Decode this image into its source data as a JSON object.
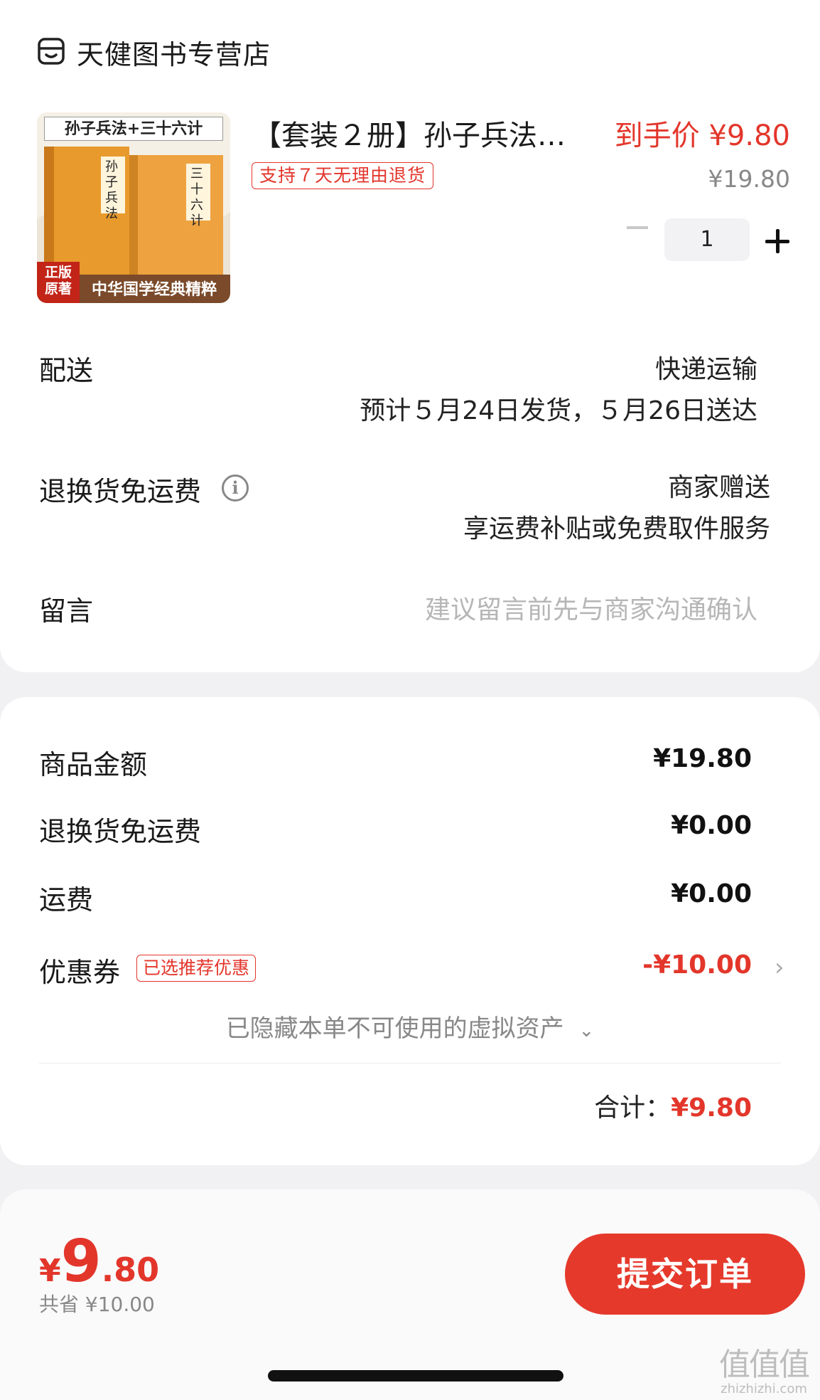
{
  "store": {
    "name": "天健图书专营店",
    "icon": "store-icon"
  },
  "product": {
    "title": "【套装２册】孙子兵法…",
    "return_badge": "支持７天无理由退货",
    "final_price_label": "到手价 ¥9.80",
    "original_price": "¥19.80",
    "quantity": "1",
    "image_text": {
      "banner": "孙子兵法+三十六计",
      "book1": "孙子兵法",
      "book2": "三十六计",
      "seal_line1": "正版",
      "seal_line2": "原著",
      "bottom": "中华国学经典精粹"
    }
  },
  "delivery": {
    "label": "配送",
    "method": "快递运输",
    "estimate": "预计５月24日发货，５月26日送达"
  },
  "return_shipping": {
    "label": "退换货免运费",
    "value": "商家赠送",
    "detail": "享运费补贴或免费取件服务",
    "icon": "info-icon"
  },
  "message": {
    "label": "留言",
    "placeholder": "建议留言前先与商家沟通确认"
  },
  "summary": {
    "goods_label": "商品金额",
    "goods_value": "¥19.80",
    "return_label": "退换货免运费",
    "return_value": "¥0.00",
    "shipping_label": "运费",
    "shipping_value": "¥0.00",
    "coupon_label": "优惠券",
    "coupon_badge": "已选推荐优惠",
    "coupon_value": "-¥10.00",
    "hidden_assets": "已隐藏本单不可使用的虚拟资产",
    "total_label": "合计：",
    "total_value": "¥9.80"
  },
  "footer": {
    "currency": "¥",
    "price_int": "9",
    "price_dec": ".80",
    "saved": "共省 ¥10.00",
    "submit": "提交订单"
  },
  "watermark": {
    "logo": "值值值",
    "url": "zhizhizhi.com"
  },
  "colors": {
    "accent": "#e3362b",
    "button": "#e5392c",
    "hint": "#b6b6b6"
  }
}
